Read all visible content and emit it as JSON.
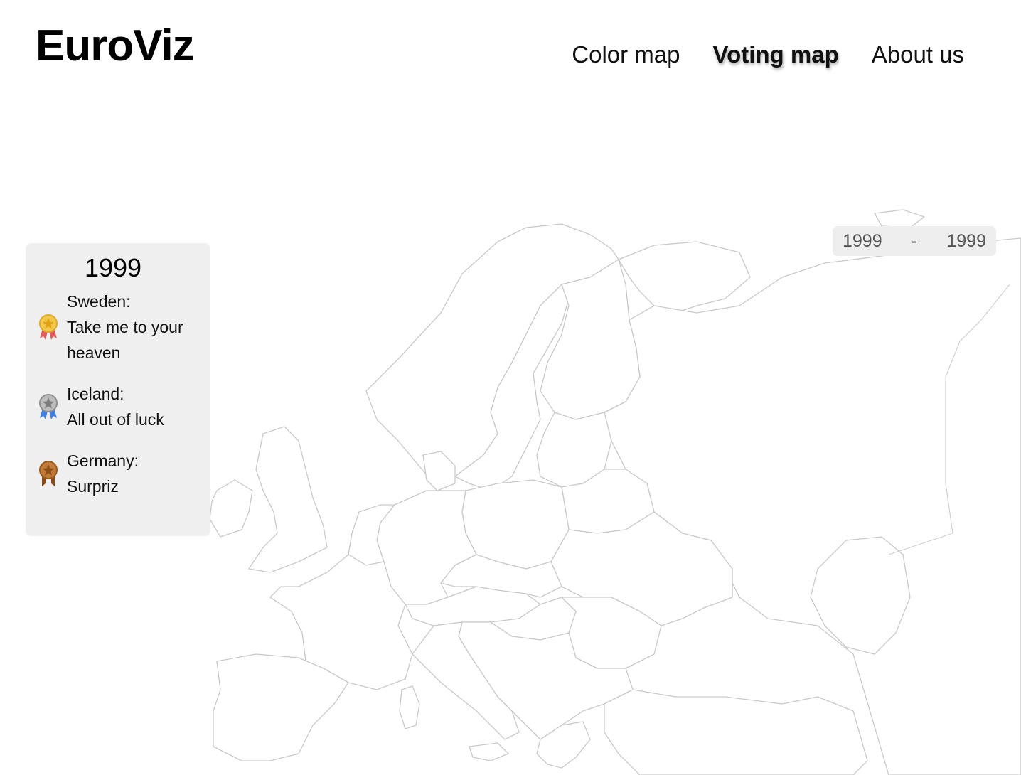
{
  "brand": "EuroViz",
  "nav": {
    "items": [
      {
        "label": "Color map",
        "active": false
      },
      {
        "label": "Voting map",
        "active": true
      },
      {
        "label": "About us",
        "active": false
      }
    ]
  },
  "range": {
    "from": "1999",
    "separator": "-",
    "to": "1999"
  },
  "panel": {
    "year": "1999",
    "entries": [
      {
        "medal": "gold-medal-icon",
        "country": "Sweden:",
        "song": "Take me to your heaven"
      },
      {
        "medal": "silver-medal-icon",
        "country": "Iceland:",
        "song": "All out of luck"
      },
      {
        "medal": "bronze-medal-icon",
        "country": "Germany:",
        "song": "Surpriz"
      }
    ]
  },
  "colors": {
    "panel_bg": "#efefef",
    "map_stroke": "#c9c9c9",
    "gold": "#f2c94c",
    "silver": "#a7a7a7",
    "bronze": "#b9722f"
  }
}
